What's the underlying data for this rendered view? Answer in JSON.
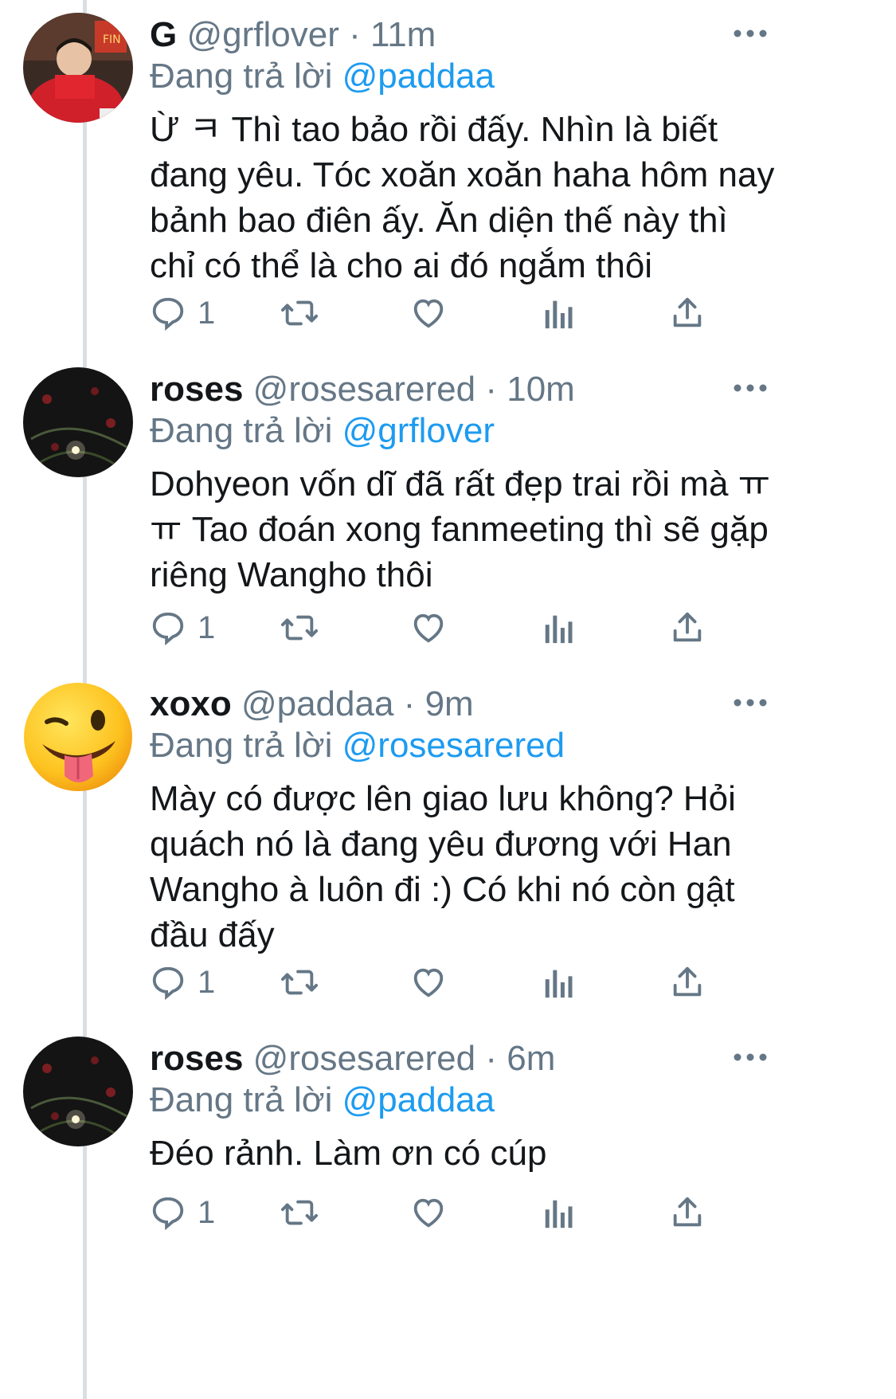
{
  "tweets": [
    {
      "name": "G",
      "handle": "@grflover",
      "dot": "·",
      "time": "11m",
      "replying_prefix": "Đang trả lời",
      "replying_to": "@paddaa",
      "text": "Ừ ㅋ Thì tao bảo rồi đấy. Nhìn là biết đang yêu. Tóc xoăn xoăn haha hôm nay bảnh bao điên ấy. Ăn diện thế này thì chỉ có thể là cho ai đó ngắm thôi",
      "reply_count": "1",
      "avatar": "red-hoodie-photo"
    },
    {
      "name": "roses",
      "handle": "@rosesarered",
      "dot": "·",
      "time": "10m",
      "replying_prefix": "Đang trả lời",
      "replying_to": "@grflover",
      "text": "Dohyeon vốn dĩ đã rất đẹp trai rồi mà ㅠ ㅠ Tao đoán xong fanmeeting thì sẽ gặp riêng Wangho thôi",
      "reply_count": "1",
      "avatar": "dark-roses-photo"
    },
    {
      "name": "xoxo",
      "handle": "@paddaa",
      "dot": "·",
      "time": "9m",
      "replying_prefix": "Đang trả lời",
      "replying_to": "@rosesarered",
      "text": "Mày có được lên giao lưu không? Hỏi quách nó là đang yêu đương với Han Wangho à luôn đi :) Có khi nó còn gật đầu đấy",
      "reply_count": "1",
      "avatar": "winking-tongue-emoji"
    },
    {
      "name": "roses",
      "handle": "@rosesarered",
      "dot": "·",
      "time": "6m",
      "replying_prefix": "Đang trả lời",
      "replying_to": "@paddaa",
      "text": "Đéo rảnh. Làm ơn có cúp",
      "reply_count": "1",
      "avatar": "dark-roses-photo"
    }
  ],
  "icons": {
    "more": "more-dots-icon",
    "reply": "reply-bubble-icon",
    "retweet": "retweet-icon",
    "like": "heart-icon",
    "stats": "analytics-bars-icon",
    "share": "share-upload-icon"
  },
  "colors": {
    "mention": "#1d9bf0",
    "secondary": "#657786",
    "text": "#14171a",
    "thread_line": "#d9dfe3"
  }
}
